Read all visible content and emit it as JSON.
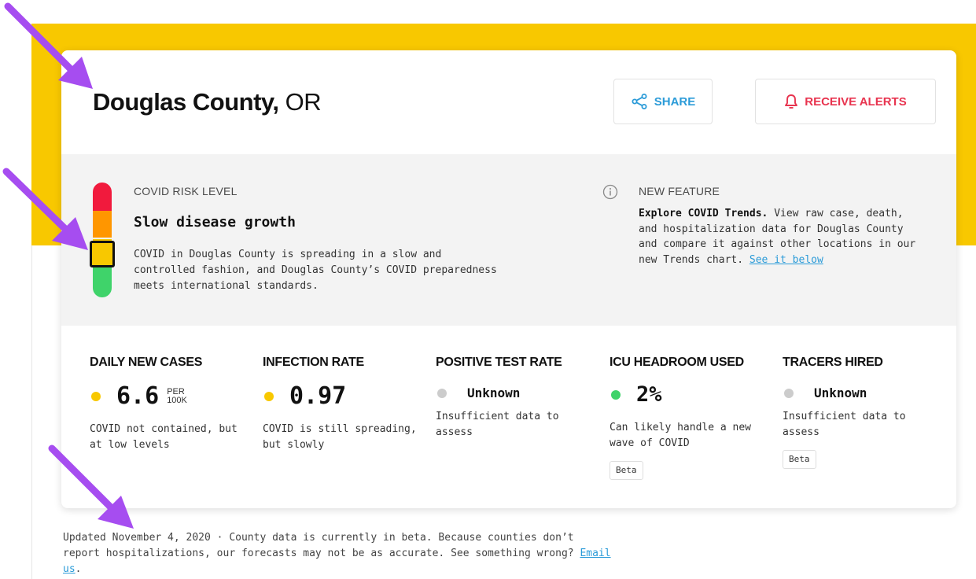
{
  "header": {
    "county": "Douglas County,",
    "state": "OR",
    "share_label": "SHARE",
    "alerts_label": "RECEIVE ALERTS"
  },
  "risk": {
    "label": "COVID RISK LEVEL",
    "heading": "Slow disease growth",
    "description": "COVID in Douglas County is spreading in a slow and controlled fashion, and Douglas County’s COVID preparedness meets international standards.",
    "meter_levels": [
      "red",
      "orange",
      "yellow",
      "green"
    ],
    "current_level": "yellow"
  },
  "feature": {
    "label": "NEW FEATURE",
    "bold": "Explore COVID Trends.",
    "text": " View raw case, death, and hospitalization data for Douglas County and compare it against other locations in our new Trends chart. ",
    "link": "See it below"
  },
  "metrics": [
    {
      "title": "DAILY NEW CASES",
      "value": "6.6",
      "unit_top": "PER",
      "unit_bottom": "100K",
      "status_color": "#f8c800",
      "description": "COVID not contained, but at low levels"
    },
    {
      "title": "INFECTION RATE",
      "value": "0.97",
      "status_color": "#f8c800",
      "description": "COVID is still spreading, but slowly"
    },
    {
      "title": "POSITIVE TEST RATE",
      "value": "Unknown",
      "status_color": "#cccccc",
      "description": "Insufficient data to assess"
    },
    {
      "title": "ICU HEADROOM USED",
      "value": "2%",
      "status_color": "#3fd36a",
      "description": "Can likely handle a new wave of COVID",
      "badge": "Beta"
    },
    {
      "title": "TRACERS HIRED",
      "value": "Unknown",
      "status_color": "#cccccc",
      "description": "Insufficient data to assess",
      "badge": "Beta"
    }
  ],
  "footer": {
    "text": "Updated November 4, 2020 · County data is currently in beta. Because counties don’t report hospitalizations, our forecasts may not be as accurate. See something wrong? ",
    "link": "Email us",
    "end": "."
  },
  "colors": {
    "brand_yellow": "#f8c800",
    "link_blue": "#2b9bd8",
    "alert_red": "#e8344f",
    "arrow_purple": "#a64df0"
  }
}
